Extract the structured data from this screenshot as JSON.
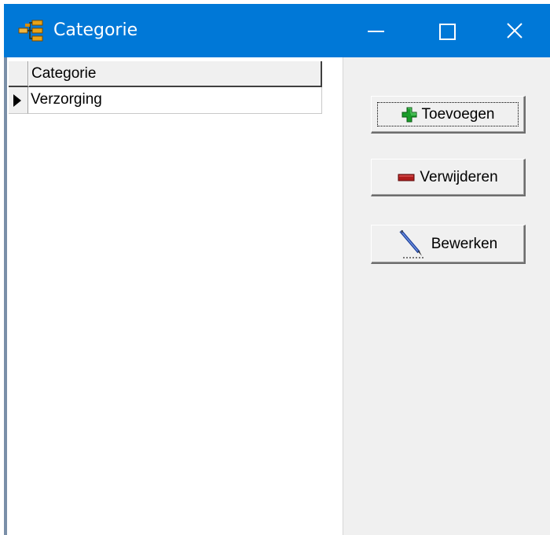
{
  "window": {
    "title": "Categorie",
    "icon": "category-tree-icon"
  },
  "titlebar_buttons": {
    "minimize_icon": "minimize-icon",
    "maximize_icon": "maximize-icon",
    "close_icon": "close-icon"
  },
  "grid": {
    "columns": [
      "Categorie"
    ],
    "rows": [
      {
        "selected": true,
        "cells": [
          "Verzorging"
        ]
      }
    ]
  },
  "actions": {
    "add_label": "Toevoegen",
    "add_icon": "green-plus-icon",
    "remove_label": "Verwijderen",
    "remove_icon": "red-minus-icon",
    "edit_label": "Bewerken",
    "edit_icon": "pen-edit-icon"
  },
  "colors": {
    "titlebar": "#0078d7",
    "window_bg": "#f0f0f0",
    "add_icon": "#1a9c2a",
    "remove_icon": "#b01c1c"
  }
}
